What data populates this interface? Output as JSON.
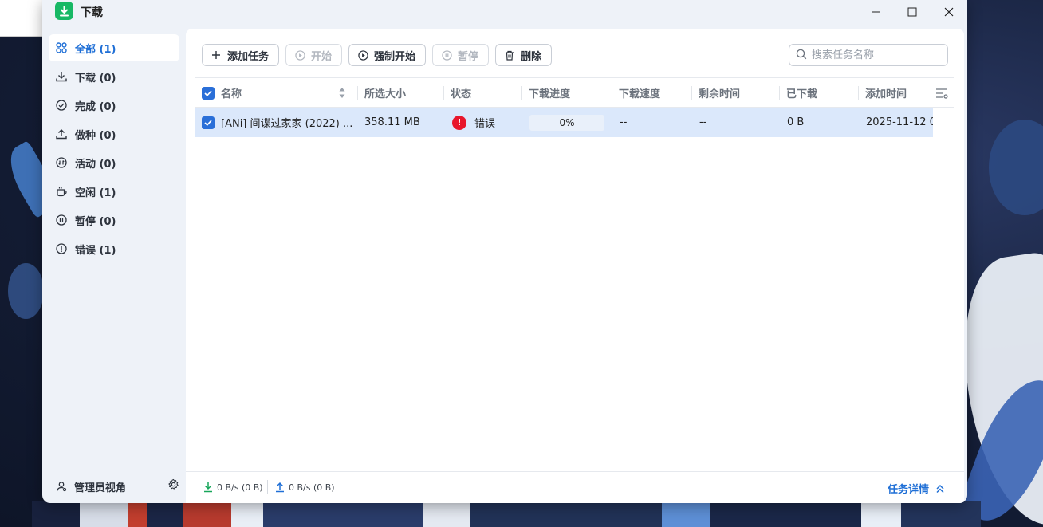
{
  "window": {
    "title": "下载",
    "accent": "#1f6fd6",
    "app_icon_color": "#17b865"
  },
  "sidebar": {
    "items": [
      {
        "label": "全部 (1)",
        "icon": "grid-icon"
      },
      {
        "label": "下载 (0)",
        "icon": "download-icon"
      },
      {
        "label": "完成 (0)",
        "icon": "check-circle-icon"
      },
      {
        "label": "做种 (0)",
        "icon": "upload-icon"
      },
      {
        "label": "活动 (0)",
        "icon": "activity-icon"
      },
      {
        "label": "空闲 (1)",
        "icon": "coffee-icon"
      },
      {
        "label": "暂停 (0)",
        "icon": "pause-circle-icon"
      },
      {
        "label": "错误 (1)",
        "icon": "alert-circle-icon"
      }
    ],
    "active_index": 0,
    "admin_label": "管理员视角"
  },
  "toolbar": {
    "add_label": "添加任务",
    "start_label": "开始",
    "force_start_label": "强制开始",
    "pause_label": "暂停",
    "delete_label": "删除"
  },
  "search": {
    "placeholder": "搜索任务名称",
    "value": ""
  },
  "table": {
    "columns": [
      "名称",
      "所选大小",
      "状态",
      "下载进度",
      "下载速度",
      "剩余时间",
      "已下载",
      "添加时间"
    ],
    "rows": [
      {
        "name": "[ANi] 间谍过家家 (2022) ...",
        "size": "358.11 MB",
        "status": "错误",
        "status_color": "#e8162b",
        "progress": "0%",
        "progress_value": 0,
        "speed": "--",
        "remaining": "--",
        "downloaded": "0 B",
        "added": "2025-11-12 0"
      }
    ]
  },
  "footer": {
    "download_speed": "0 B/s (0 B)",
    "upload_speed": "0 B/s (0 B)",
    "details_label": "任务详情"
  }
}
